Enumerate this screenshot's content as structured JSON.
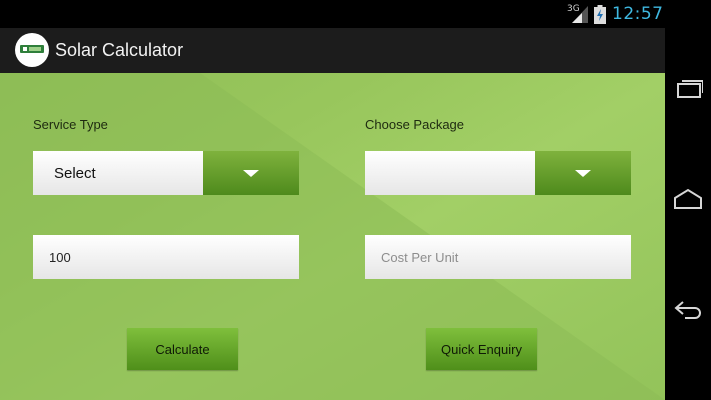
{
  "status_bar": {
    "network": "3G",
    "time": "12:57",
    "time_color": "#3fb8e0"
  },
  "action_bar": {
    "title": "Solar Calculator",
    "logo_icon": "app-logo-icon"
  },
  "form": {
    "service_type": {
      "label": "Service Type",
      "selected": "Select"
    },
    "choose_package": {
      "label": "Choose Package",
      "selected": ""
    },
    "units_input": {
      "value": "100",
      "placeholder": ""
    },
    "cost_per_unit_input": {
      "value": "",
      "placeholder": "Cost Per Unit"
    },
    "calculate_label": "Calculate",
    "quick_enquiry_label": "Quick Enquiry"
  },
  "colors": {
    "background_green": "#98c65c",
    "button_green": "#5f9c25",
    "action_bar": "#1c1c1c"
  },
  "nav_bar": {
    "icons": [
      "recent-apps-icon",
      "home-icon",
      "back-icon"
    ]
  }
}
